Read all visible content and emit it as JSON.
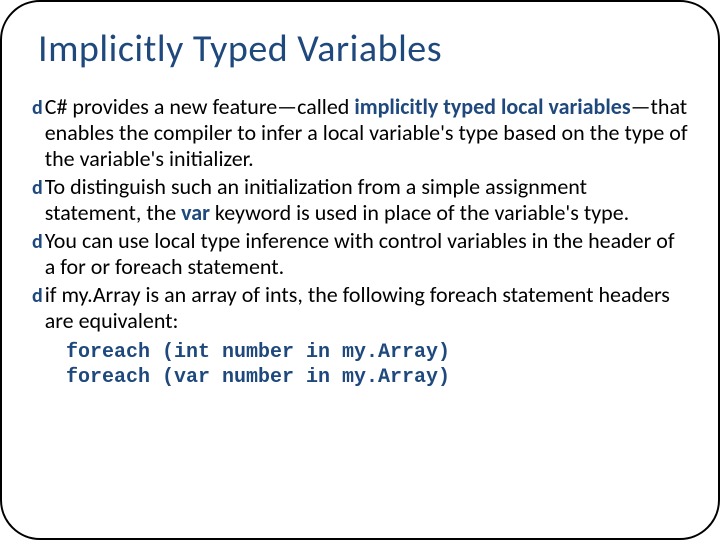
{
  "title": "Implicitly Typed Variables",
  "bullets": {
    "b1a": "C# provides a new feature—called ",
    "b1b": "implicitly typed local variables",
    "b1c": "—that enables the compiler to infer a local variable's type based on the type of the variable's initializer.",
    "b2a": "To distinguish such an initialization from a simple assignment statement, the ",
    "b2b": "var",
    "b2c": " keyword is used in place of the variable's type.",
    "b3": "You can use local type inference with control variables in the header of a for or foreach statement.",
    "b4": "if my.Array is an array of ints, the following foreach statement headers are equivalent:"
  },
  "code": {
    "line1": "foreach (int number in my.Array)",
    "line2": "foreach (var number in my.Array)"
  },
  "icons": {
    "bullet": "d"
  }
}
